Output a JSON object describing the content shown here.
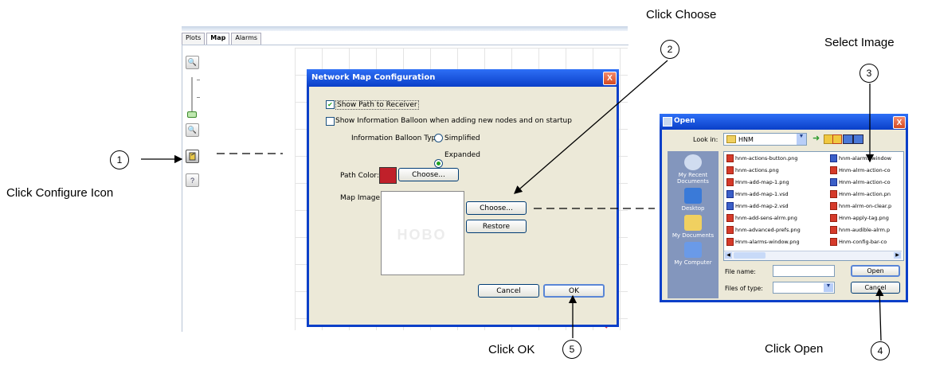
{
  "app": {
    "tabs": [
      {
        "label": "Plots"
      },
      {
        "label": "Map"
      },
      {
        "label": "Alarms"
      }
    ]
  },
  "dialog": {
    "title": "Network Map Configuration",
    "show_path_label": "Show Path to Receiver",
    "show_path_checked": true,
    "show_balloon_label": "Show Information Balloon when adding new nodes and on startup",
    "show_balloon_checked": false,
    "balloon_type_label": "Information Balloon Type:",
    "balloon_simplified": "Simplified",
    "balloon_expanded": "Expanded",
    "balloon_selected": "Expanded",
    "path_color_label": "Path Color:",
    "path_color": "#c0202a",
    "choose_color_label": "Choose...",
    "map_image_label": "Map Image:",
    "image_watermark": "HOBO",
    "choose_image_label": "Choose...",
    "restore_label": "Restore",
    "cancel_label": "Cancel",
    "ok_label": "OK",
    "close_glyph": "X"
  },
  "open_dialog": {
    "title": "Open",
    "look_in_label": "Look in:",
    "look_in_value": "HNM",
    "places": [
      {
        "label": "My Recent Documents"
      },
      {
        "label": "Desktop"
      },
      {
        "label": "My Documents"
      },
      {
        "label": "My Computer"
      }
    ],
    "files_col1": [
      {
        "name": "hnm-actions-button.png",
        "type": "png"
      },
      {
        "name": "hnm-actions.png",
        "type": "png"
      },
      {
        "name": "Hnm-add-map-1.png",
        "type": "png"
      },
      {
        "name": "Hnm-add-map-1.vsd",
        "type": "vsd"
      },
      {
        "name": "Hnm-add-map-2.vsd",
        "type": "vsd"
      },
      {
        "name": "hnm-add-sens-alrm.png",
        "type": "png"
      },
      {
        "name": "hnm-advanced-prefs.png",
        "type": "png"
      },
      {
        "name": "Hnm-alarms-window.png",
        "type": "png"
      }
    ],
    "files_col2": [
      {
        "name": "hnm-alarms-window",
        "type": "vsd"
      },
      {
        "name": "Hnm-alrm-action-co",
        "type": "png"
      },
      {
        "name": "Hnm-alrm-action-co",
        "type": "vsd"
      },
      {
        "name": "Hnm-alrm-action.pn",
        "type": "png"
      },
      {
        "name": "hnm-alrm-on-clear.p",
        "type": "png"
      },
      {
        "name": "Hnm-apply-tag.png",
        "type": "png"
      },
      {
        "name": "hnm-audible-alrm.p",
        "type": "png"
      },
      {
        "name": "Hnm-config-bar-co",
        "type": "png"
      }
    ],
    "file_name_label": "File name:",
    "file_name_value": "",
    "files_of_type_label": "Files of type:",
    "files_of_type_value": "",
    "open_label": "Open",
    "cancel_label": "Cancel",
    "close_glyph": "X"
  },
  "annotations": {
    "step1_label": "Click Configure Icon",
    "step2_label": "Click Choose",
    "step3_label": "Select Image",
    "step4_label": "Click Open",
    "step5_label": "Click OK",
    "n1": "1",
    "n2": "2",
    "n3": "3",
    "n4": "4",
    "n5": "5"
  },
  "colors": {
    "titlebar": "#0a3fc8",
    "dialog_bg": "#ece9d8"
  }
}
